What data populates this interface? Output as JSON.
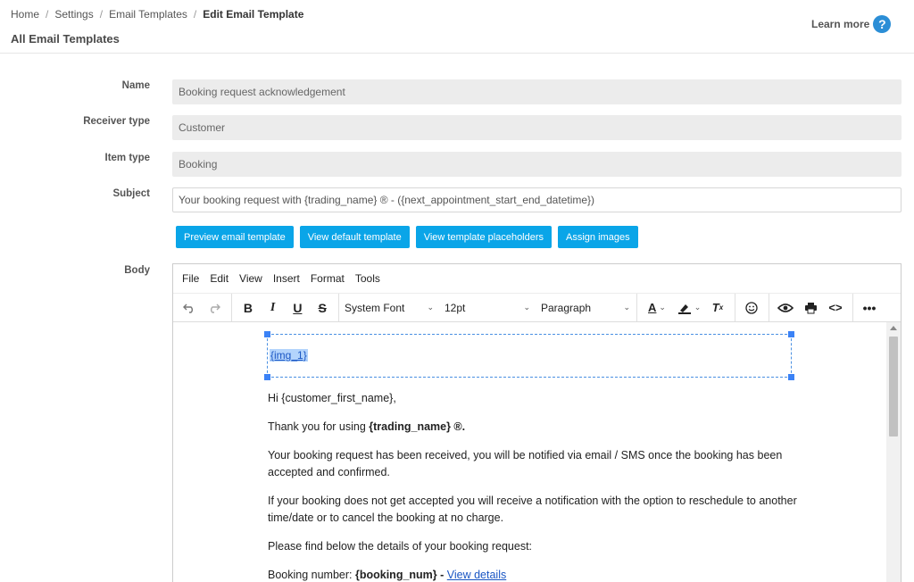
{
  "breadcrumb": {
    "items": [
      "Home",
      "Settings",
      "Email Templates"
    ],
    "current": "Edit Email Template",
    "separator": "/"
  },
  "header": {
    "title": "All Email Templates",
    "learn_more": "Learn more",
    "help_icon": "?"
  },
  "form": {
    "name_label": "Name",
    "name_value": "Booking request acknowledgement",
    "receiver_label": "Receiver type",
    "receiver_value": "Customer",
    "item_label": "Item type",
    "item_value": "Booking",
    "subject_label": "Subject",
    "subject_value": "Your booking request with {trading_name} ® - ({next_appointment_start_end_datetime})",
    "body_label": "Body"
  },
  "buttons": {
    "preview": "Preview email template",
    "default": "View default template",
    "placeholders": "View template placeholders",
    "assign_images": "Assign images"
  },
  "editor": {
    "menu": [
      "File",
      "Edit",
      "View",
      "Insert",
      "Format",
      "Tools"
    ],
    "font": "System Font",
    "size": "12pt",
    "block": "Paragraph",
    "body": {
      "image_placeholder": "{img_1}",
      "greeting": "Hi {customer_first_name},",
      "thanks_prefix": "Thank you for using ",
      "thanks_bold": "{trading_name} ®.",
      "received": "Your booking request has been received, you will be notified via email / SMS once the booking has been accepted and confirmed.",
      "not_accepted": "If your booking does not get accepted you will receive a notification with the option to reschedule to another time/date or to cancel the booking at no charge.",
      "details_intro": "Please find below the details of your booking request:",
      "booking_number_label": "Booking number: ",
      "booking_number_value": "{booking_num}",
      "booking_dash": " - ",
      "view_details": "View details"
    }
  },
  "colors": {
    "accent": "#0aa5e8",
    "help": "#2b8ed6",
    "link": "#1a56c4",
    "disabled_field": "#ececec"
  }
}
